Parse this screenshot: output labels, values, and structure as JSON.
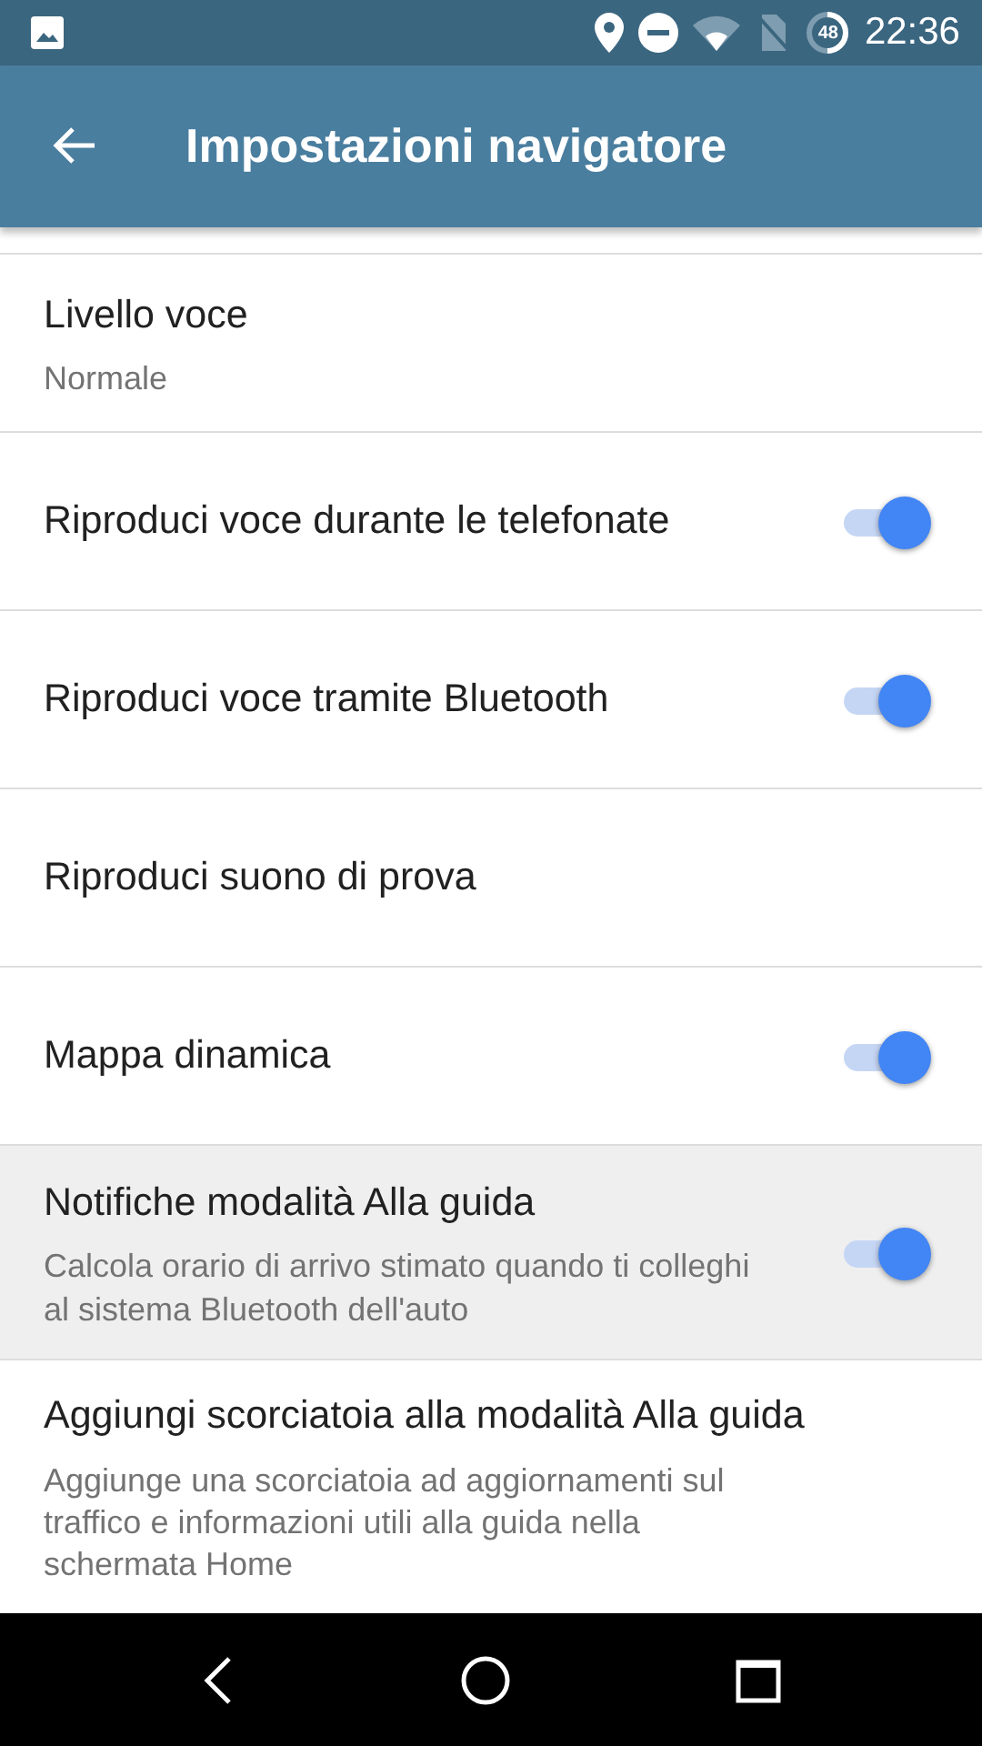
{
  "status_bar": {
    "time": "22:36",
    "battery": "48"
  },
  "app_bar": {
    "title": "Impostazioni navigatore"
  },
  "settings": [
    {
      "title": "Livello voce",
      "summary": "Normale",
      "selected": false
    },
    {
      "title": "Riproduci voce durante le telefonate",
      "toggle": {
        "on": true
      },
      "selected": false
    },
    {
      "title": "Riproduci voce tramite Bluetooth",
      "toggle": {
        "on": true
      },
      "selected": false
    },
    {
      "title": "Riproduci suono di prova",
      "selected": false
    },
    {
      "title": "Mappa dinamica",
      "toggle": {
        "on": true
      },
      "selected": false
    },
    {
      "title": "Notifiche modalità Alla guida",
      "summary": "Calcola orario di arrivo stimato quando ti colleghi al sistema Bluetooth dell'auto",
      "toggle": {
        "on": true
      },
      "selected": true
    },
    {
      "title": "Aggiungi scorciatoia alla modalità Alla guida",
      "summary": "Aggiunge una scorciatoia ad aggiornamenti sul traffico e informazioni utili alla guida nella schermata Home",
      "selected": false
    }
  ]
}
